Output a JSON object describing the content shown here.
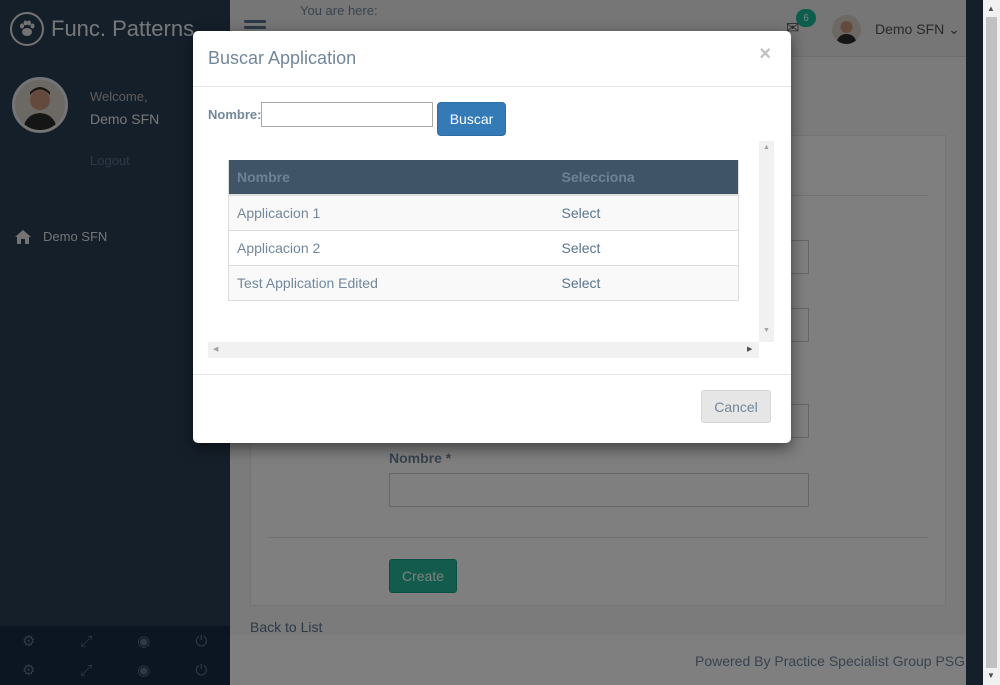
{
  "sidebar": {
    "brand": "Func. Patterns",
    "welcome": "Welcome,",
    "user_name": "Demo SFN",
    "logout": "Logout",
    "nav_item": "Demo SFN"
  },
  "topnav": {
    "breadcrumb_label": "You are here:",
    "mail_count": "6",
    "user_name": "Demo SFN"
  },
  "form": {
    "nombre_label": "Nombre *",
    "create_label": "Create",
    "back_link": "Back to List",
    "powered_by": "Powered By Practice Specialist Group PSG"
  },
  "modal": {
    "title": "Buscar Application",
    "close": "×",
    "search_label": "Nombre:",
    "search_value": "",
    "search_button": "Buscar",
    "columns": [
      "Nombre",
      "Selecciona"
    ],
    "rows": [
      {
        "name": "Applicacion 1",
        "action": "Select"
      },
      {
        "name": "Applicacion 2",
        "action": "Select"
      },
      {
        "name": "Test Application Edited",
        "action": "Select"
      }
    ],
    "cancel": "Cancel"
  }
}
